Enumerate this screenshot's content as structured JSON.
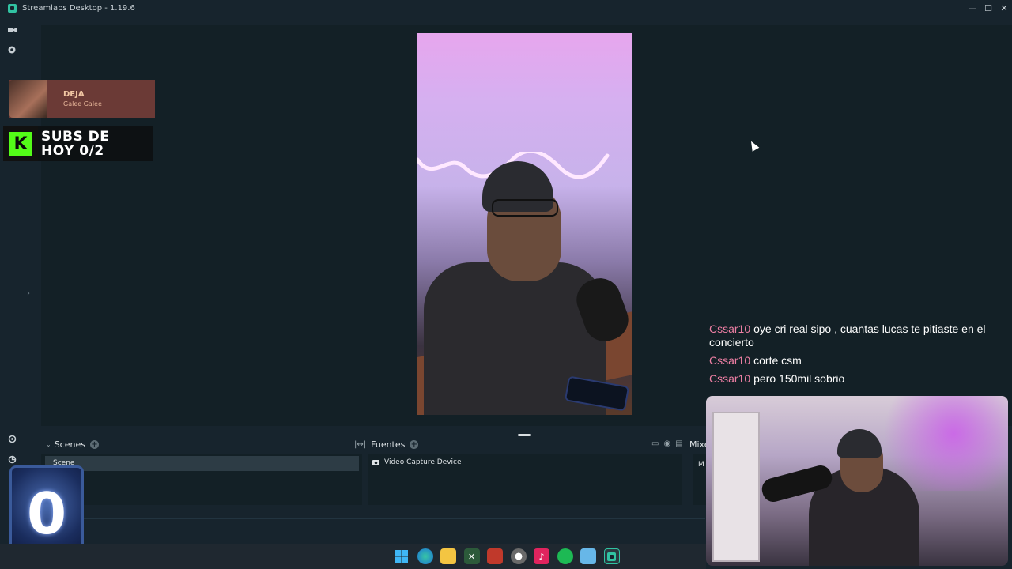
{
  "window": {
    "title": "Streamlabs Desktop - 1.19.6",
    "controls": {
      "minimize": "—",
      "maximize": "☐",
      "close": "✕"
    }
  },
  "nav": {
    "icons": [
      "editor-icon",
      "themes-icon",
      "settings-icon",
      "studio-mode-icon"
    ],
    "collapse_glyph": "›"
  },
  "now_playing": {
    "title": "DEJA",
    "artist": "Galee Galee"
  },
  "subs_widget": {
    "logo_letter": "K",
    "line1": "SUBS DE",
    "line2": "HOY 0/2"
  },
  "dock": {
    "scenes": {
      "header": "Scenes",
      "items": [
        "Scene"
      ]
    },
    "sources": {
      "header": "Fuentes",
      "items": [
        "Video Capture Device"
      ]
    },
    "mixer": {
      "header": "Mixe",
      "body_fragment": "M"
    }
  },
  "chat": {
    "messages": [
      {
        "user": "Cssar10",
        "text": "oye cri real sipo , cuantas lucas te pitiaste en el concierto"
      },
      {
        "user": "Cssar10",
        "text": "corte csm"
      },
      {
        "user": "Cssar10",
        "text": "pero 150mil sobrio"
      }
    ]
  },
  "badge": {
    "value": "0"
  },
  "taskbar": {
    "icons": [
      "windows-start-icon",
      "edge-icon",
      "file-explorer-icon",
      "excel-icon",
      "voice-app-icon",
      "chrome-icon",
      "tiktok-icon",
      "spotify-icon",
      "notepad-icon",
      "streamlabs-icon"
    ]
  },
  "colors": {
    "background": "#17242d",
    "chat_username": "#ee7fa4",
    "accent": "#31c3a2",
    "kick_green": "#53fc18",
    "now_playing_bg": "#6b3a36"
  }
}
